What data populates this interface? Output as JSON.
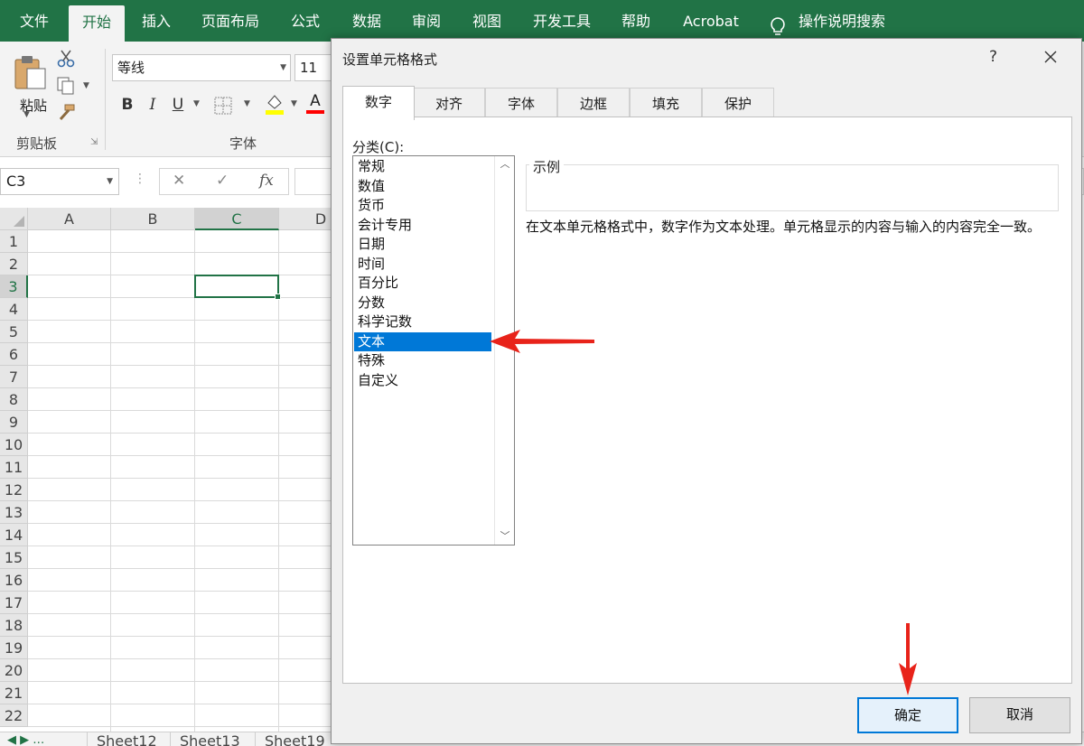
{
  "ribbon": {
    "tabs": [
      "文件",
      "开始",
      "插入",
      "页面布局",
      "公式",
      "数据",
      "审阅",
      "视图",
      "开发工具",
      "帮助",
      "Acrobat"
    ],
    "active_tab": "开始",
    "tell_me": "操作说明搜索",
    "clipboard": {
      "paste_label": "粘贴",
      "group_label": "剪贴板"
    },
    "font": {
      "name": "等线",
      "size": "11",
      "bold": "B",
      "italic": "I",
      "underline": "U",
      "color_glyph": "A",
      "group_label": "字体",
      "colors": {
        "highlight": "#ffff00",
        "font_color": "#ff0000"
      }
    }
  },
  "formula_bar": {
    "name_box": "C3",
    "cancel_glyph": "✕",
    "enter_glyph": "✓",
    "fx_glyph": "fx",
    "value": ""
  },
  "sheet": {
    "columns": [
      "A",
      "B",
      "C",
      "D"
    ],
    "selected_column": "C",
    "rows": [
      "1",
      "2",
      "3",
      "4",
      "5",
      "6",
      "7",
      "8",
      "9",
      "10",
      "11",
      "12",
      "13",
      "14",
      "15",
      "16",
      "17",
      "18",
      "19",
      "20",
      "21",
      "22"
    ],
    "selected_row": "3",
    "tabs": [
      "Sheet12",
      "Sheet13",
      "Sheet19"
    ]
  },
  "dialog": {
    "title": "设置单元格格式",
    "help": "?",
    "tabs": [
      "数字",
      "对齐",
      "字体",
      "边框",
      "填充",
      "保护"
    ],
    "active_tab": "数字",
    "category_label": "分类(C):",
    "categories": [
      "常规",
      "数值",
      "货币",
      "会计专用",
      "日期",
      "时间",
      "百分比",
      "分数",
      "科学记数",
      "文本",
      "特殊",
      "自定义"
    ],
    "selected_category": "文本",
    "sample_label": "示例",
    "description": "在文本单元格格式中，数字作为文本处理。单元格显示的内容与输入的内容完全一致。",
    "ok_label": "确定",
    "cancel_label": "取消"
  },
  "colors": {
    "accent": "#217346",
    "selection": "#0078d7",
    "annotation": "#e8231a"
  },
  "icons": [
    "paste-icon",
    "cut-icon",
    "copy-icon",
    "format-painter-icon",
    "border-icon",
    "fill-color-icon",
    "font-color-icon",
    "lightbulb-icon",
    "close-icon",
    "chevron-up-icon",
    "chevron-down-icon"
  ]
}
